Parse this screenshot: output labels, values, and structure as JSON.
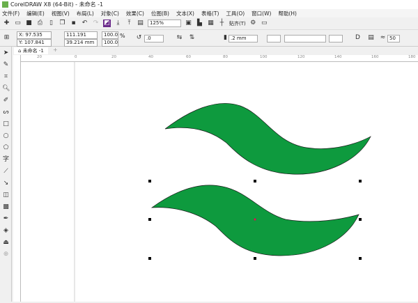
{
  "window": {
    "title": "CorelDRAW X8 (64-Bit) - 未命名 -1"
  },
  "menu": [
    "文件(F)",
    "编辑(E)",
    "视图(V)",
    "布局(L)",
    "对象(C)",
    "效果(C)",
    "位图(B)",
    "文本(X)",
    "表格(T)",
    "工具(O)",
    "窗口(W)",
    "帮助(H)"
  ],
  "toolbar": {
    "zoom": "125%",
    "snap": "贴齐(T)"
  },
  "propbar": {
    "x": "X: 97.535 mm",
    "y": "Y: 107.841 mm",
    "width": "111.191 mm",
    "height": "39.214 mm",
    "scale_x": "100.0",
    "scale_y": "100.0",
    "pct": "%",
    "rotation": ".0",
    "outline": ".2 mm",
    "miter": "50"
  },
  "tab": {
    "label": "未命名 -1"
  },
  "ruler": {
    "labels": [
      "20",
      "0",
      "20",
      "40",
      "60",
      "80",
      "100",
      "120",
      "140",
      "160",
      "180"
    ]
  },
  "shapes": {
    "fill": "#0e9a3e",
    "stroke": "#1a1a1a"
  }
}
